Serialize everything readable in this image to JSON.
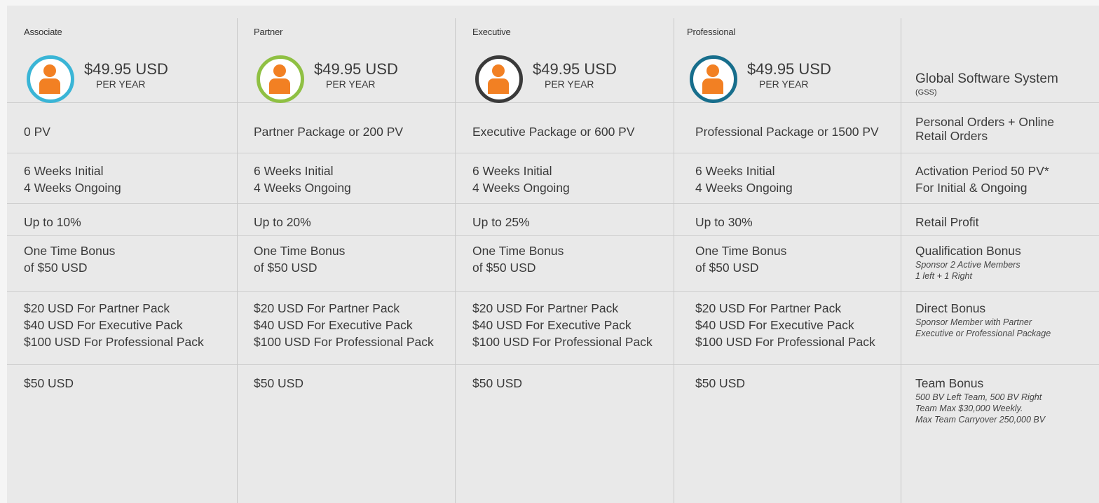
{
  "plans": [
    {
      "name": "Associate",
      "price": "$49.95 USD",
      "period": "PER YEAR",
      "ring_color": "#3ab5d6",
      "icon": "person-icon",
      "pv": "0 PV",
      "activation": [
        "6 Weeks Initial",
        "4 Weeks Ongoing"
      ],
      "retail": "Up to 10%",
      "qualification": [
        "One Time Bonus",
        "of $50 USD"
      ],
      "direct": [
        "$20 USD For Partner Pack",
        "$40 USD For Executive Pack",
        "$100 USD For Professional Pack"
      ],
      "team": "$50 USD"
    },
    {
      "name": "Partner",
      "price": "$49.95 USD",
      "period": "PER YEAR",
      "ring_color": "#8fc043",
      "icon": "person-icon",
      "pv": "Partner Package or 200 PV",
      "activation": [
        "6 Weeks Initial",
        "4 Weeks Ongoing"
      ],
      "retail": "Up to 20%",
      "qualification": [
        "One Time Bonus",
        "of $50 USD"
      ],
      "direct": [
        "$20 USD For Partner Pack",
        "$40 USD For Executive Pack",
        "$100 USD For Professional Pack"
      ],
      "team": "$50 USD"
    },
    {
      "name": "Executive",
      "price": "$49.95 USD",
      "period": "PER YEAR",
      "ring_color": "#3a3a3a",
      "icon": "person-icon",
      "pv": "Executive Package or 600 PV",
      "activation": [
        "6 Weeks Initial",
        "4 Weeks Ongoing"
      ],
      "retail": "Up to 25%",
      "qualification": [
        "One Time Bonus",
        "of $50 USD"
      ],
      "direct": [
        "$20 USD For Partner Pack",
        "$40 USD For Executive Pack",
        "$100 USD For Professional Pack"
      ],
      "team": "$50 USD"
    },
    {
      "name": "Professional",
      "price": "$49.95 USD",
      "period": "PER YEAR",
      "ring_color": "#176e8c",
      "icon": "person-icon",
      "pv": "Professional Package or 1500 PV",
      "activation": [
        "6 Weeks Initial",
        "4 Weeks Ongoing"
      ],
      "retail": "Up to 30%",
      "qualification": [
        "One Time Bonus",
        "of $50 USD"
      ],
      "direct": [
        "$20 USD For Partner Pack",
        "$40 USD For Executive Pack",
        "$100 USD For Professional Pack"
      ],
      "team": "$50 USD"
    }
  ],
  "features": {
    "title": "Global Software System",
    "title_sub": "(GSS)",
    "pv": [
      "Personal Orders + Online",
      "Retail Orders"
    ],
    "activation": [
      "Activation Period 50 PV*",
      "For Initial & Ongoing"
    ],
    "retail": "Retail Profit",
    "qualification": {
      "title": "Qualification Bonus",
      "notes": [
        "Sponsor 2 Active Members",
        "1 left + 1 Right"
      ]
    },
    "direct": {
      "title": "Direct Bonus",
      "notes": [
        "Sponsor Member with Partner",
        "Executive or Professional Package"
      ]
    },
    "team": {
      "title": "Team Bonus",
      "notes": [
        "500 BV Left Team, 500 BV Right",
        "Team Max $30,000 Weekly.",
        "Max Team Carryover 250,000 BV"
      ]
    }
  }
}
